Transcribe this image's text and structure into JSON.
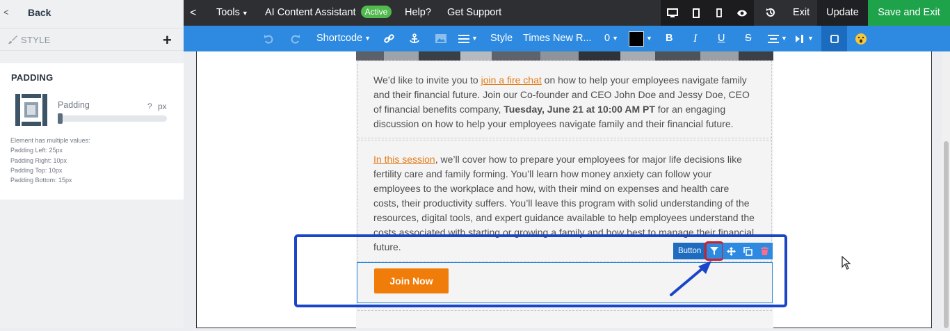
{
  "sidebar": {
    "back_label": "Back",
    "style_label": "STYLE",
    "panel_title": "PADDING",
    "padding_label": "Padding",
    "padding_value": "?",
    "padding_unit": "px",
    "multi_heading": "Element has multiple values:",
    "multi_values": [
      "Padding Left: 25px",
      "Padding Right: 10px",
      "Padding Top: 10px",
      "Padding Bottom: 15px"
    ]
  },
  "topbar": {
    "tools": "Tools",
    "ai_assistant": "AI Content Assistant",
    "ai_status": "Active",
    "help": "Help?",
    "support": "Get Support",
    "exit": "Exit",
    "update": "Update",
    "save_exit": "Save and Exit"
  },
  "editbar": {
    "shortcode": "Shortcode",
    "style": "Style",
    "font": "Times New R...",
    "font_size": "0",
    "text_color": "#000000"
  },
  "email": {
    "block1": {
      "t1": "We’d like to invite you to ",
      "link": "join a fire chat",
      "t2": " on how to help your employees navigate family and their financial future. Join our Co-founder and CEO John Doe and Jessy Doe, CEO of financial benefits company, ",
      "bold": "Tuesday, June 21 at 10:00 AM PT",
      "t3": " for an engaging discussion on how to help your employees navigate family and their financial future."
    },
    "block2": {
      "link": "In this session",
      "t1": ", we’ll cover how to prepare your employees for major life decisions like fertility care and family forming. You’ll learn how money anxiety can follow your employees to the workplace and how, with their mind on expenses and health care costs, their productivity suffers. You’ll leave this program with solid understanding of the resources, digital tools, and expert guidance available to help employees understand the costs associated with starting or growing a family and how best to manage their financial future."
    },
    "button_label": "Join Now",
    "block_type_label": "Button"
  },
  "colors": {
    "topbar": "#2e2f33",
    "editbar": "#2d8ae0",
    "save": "#1fa34a",
    "cta": "#f07d0a",
    "annotation": "#1a45c9",
    "highlight": "#cc1f2a"
  }
}
